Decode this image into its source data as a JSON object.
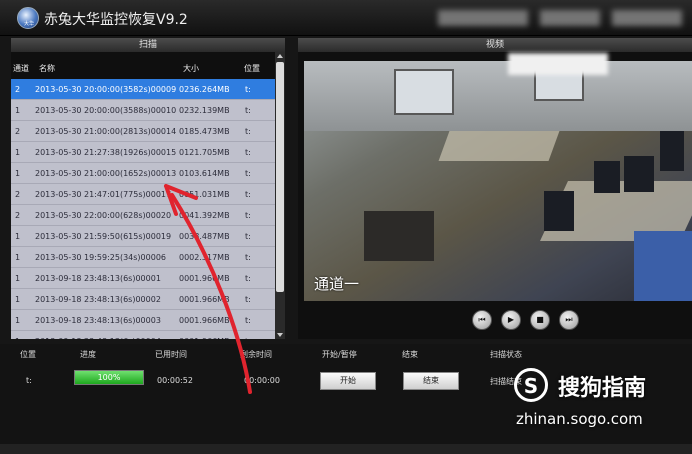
{
  "app": {
    "title": "赤兔大华监控恢复V9.2",
    "logo_text": "大华"
  },
  "scan_panel": {
    "header": "扫描",
    "columns": [
      "通道",
      "名称",
      "大小",
      "位置"
    ],
    "rows": [
      {
        "ch": "2",
        "name": "2013-05-30 20:00:00(3582s)00009",
        "size": "0236.264MB",
        "pos": "t:",
        "selected": true
      },
      {
        "ch": "1",
        "name": "2013-05-30 20:00:00(3588s)00010",
        "size": "0232.139MB",
        "pos": "t:"
      },
      {
        "ch": "2",
        "name": "2013-05-30 21:00:00(2813s)00014",
        "size": "0185.473MB",
        "pos": "t:"
      },
      {
        "ch": "1",
        "name": "2013-05-30 21:27:38(1926s)00015",
        "size": "0121.705MB",
        "pos": "t:"
      },
      {
        "ch": "1",
        "name": "2013-05-30 21:00:00(1652s)00013",
        "size": "0103.614MB",
        "pos": "t:"
      },
      {
        "ch": "2",
        "name": "2013-05-30 21:47:01(775s)00017",
        "size": "0051.031MB",
        "pos": "t:"
      },
      {
        "ch": "2",
        "name": "2013-05-30 22:00:00(628s)00020",
        "size": "0041.392MB",
        "pos": "t:"
      },
      {
        "ch": "1",
        "name": "2013-05-30 21:59:50(615s)00019",
        "size": "0038.487MB",
        "pos": "t:"
      },
      {
        "ch": "1",
        "name": "2013-05-30 19:59:25(34s)00006",
        "size": "0002.317MB",
        "pos": "t:"
      },
      {
        "ch": "1",
        "name": "2013-09-18 23:48:13(6s)00001",
        "size": "0001.966MB",
        "pos": "t:"
      },
      {
        "ch": "1",
        "name": "2013-09-18 23:48:13(6s)00002",
        "size": "0001.966MB",
        "pos": "t:"
      },
      {
        "ch": "1",
        "name": "2013-09-18 23:48:13(6s)00003",
        "size": "0001.966MB",
        "pos": "t:"
      },
      {
        "ch": "1",
        "name": "2013-09-18 23:48:13(6s)00004",
        "size": "0001.966MB",
        "pos": "t:"
      }
    ]
  },
  "video_panel": {
    "header": "视频",
    "channel_label": "通道一",
    "controls": {
      "prev": "⏮",
      "play": "▶",
      "stop": "■",
      "next": "⏭"
    }
  },
  "status": {
    "columns": [
      "位置",
      "进度",
      "已用时间",
      "剩余时间",
      "开始/暂停",
      "结束",
      "扫描状态"
    ],
    "position": "t:",
    "progress_label": "100%",
    "progress_fraction": 1.0,
    "elapsed": "00:00:52",
    "remaining": "00:00:00",
    "start_button": "开始",
    "end_button": "结束",
    "scan_state": "扫描结束"
  },
  "watermark": {
    "glyph": "S",
    "name": "搜狗指南",
    "url": "zhinan.sogo.com"
  },
  "colors": {
    "selected_row": "#2f7de0",
    "annotation_arrow": "#e0242e",
    "progress_green": "#1ea81e"
  }
}
